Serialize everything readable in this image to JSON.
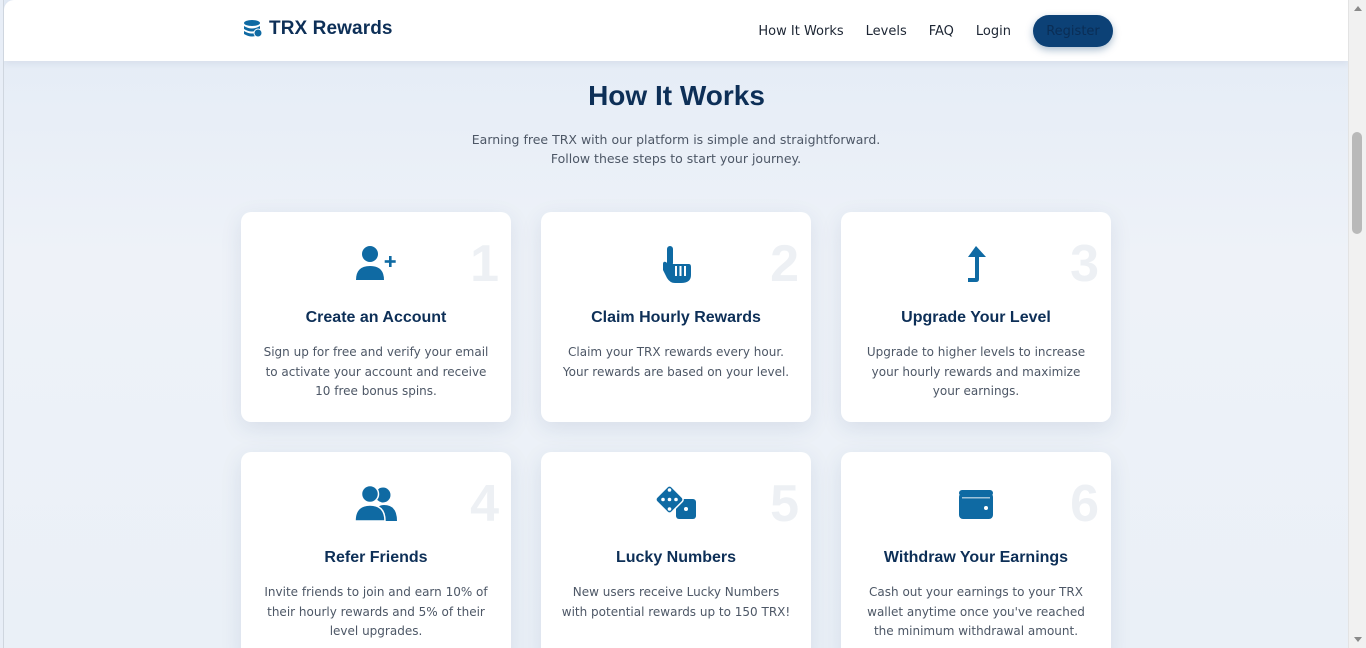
{
  "brand": {
    "name": "TRX Rewards",
    "icon": "coins-icon"
  },
  "nav": {
    "items": [
      "How It Works",
      "Levels",
      "FAQ",
      "Login"
    ],
    "register_label": "Register"
  },
  "section": {
    "title": "How It Works",
    "subtitle": "Earning free TRX with our platform is simple and straightforward. Follow these steps to start your journey."
  },
  "steps": [
    {
      "number": "1",
      "icon": "user-plus-icon",
      "title": "Create an Account",
      "description": "Sign up for free and verify your email to activate your account and receive 10 free bonus spins."
    },
    {
      "number": "2",
      "icon": "hand-pointer-icon",
      "title": "Claim Hourly Rewards",
      "description": "Claim your TRX rewards every hour. Your rewards are based on your level."
    },
    {
      "number": "3",
      "icon": "level-up-icon",
      "title": "Upgrade Your Level",
      "description": "Upgrade to higher levels to increase your hourly rewards and maximize your earnings."
    },
    {
      "number": "4",
      "icon": "users-icon",
      "title": "Refer Friends",
      "description": "Invite friends to join and earn 10% of their hourly rewards and 5% of their level upgrades."
    },
    {
      "number": "5",
      "icon": "dice-icon",
      "title": "Lucky Numbers",
      "description": "New users receive Lucky Numbers with potential rewards up to 150 TRX!"
    },
    {
      "number": "6",
      "icon": "wallet-icon",
      "title": "Withdraw Your Earnings",
      "description": "Cash out your earnings to your TRX wallet anytime once you've reached the minimum withdrawal amount."
    }
  ],
  "colors": {
    "accent": "#0c4176",
    "heading": "#0d2f57",
    "icon": "#0f6aa3"
  }
}
